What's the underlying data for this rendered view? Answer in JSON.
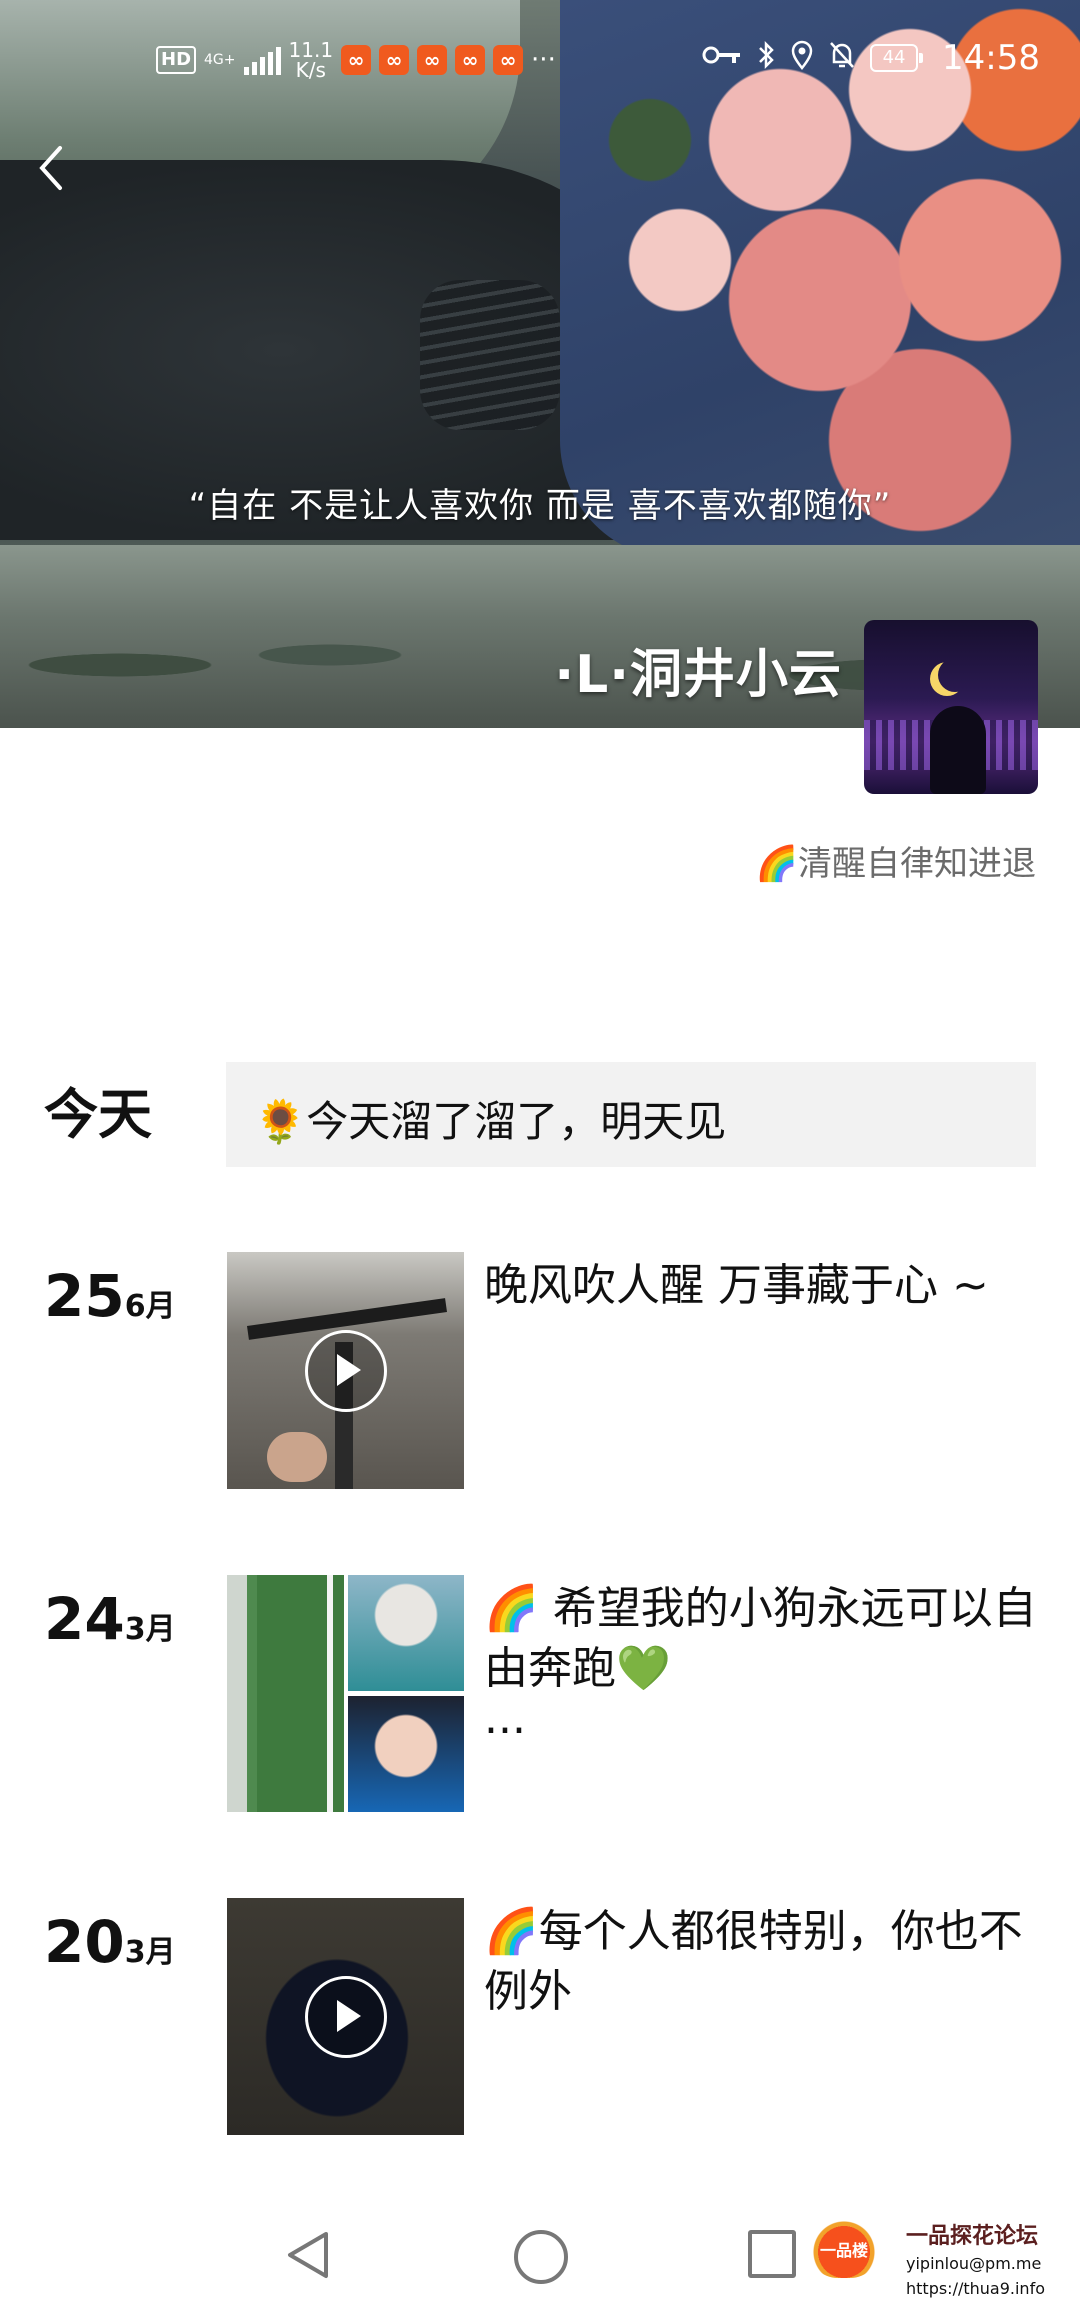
{
  "status_bar": {
    "hd": "HD",
    "network": "4G+",
    "speed_value": "11.1",
    "speed_unit": "K/s",
    "more": "···",
    "battery": "44",
    "time": "14:58"
  },
  "cover": {
    "caption": "“自在 不是让人喜欢你 而是 喜不喜欢都随你”"
  },
  "profile": {
    "nickname": "·L·洞井小云",
    "signature": "🌈清醒自律知进退"
  },
  "feed": [
    {
      "day": "今天",
      "month": "",
      "text": "🌻今天溜了溜了，明天见",
      "media": "none"
    },
    {
      "day": "25",
      "month": "6月",
      "text": "晚风吹人醒  万事藏于心 ~",
      "media": "video"
    },
    {
      "day": "24",
      "month": "3月",
      "text": "🌈 希望我的小狗永远可以自由奔跑💚",
      "more": "...",
      "media": "photos"
    },
    {
      "day": "20",
      "month": "3月",
      "text": "🌈每个人都很特别，你也不例外",
      "media": "video"
    }
  ],
  "watermark": {
    "logo_text": "一品楼",
    "title": "一品探花论坛",
    "email": "yipinlou@pm.me",
    "url": "https://thua9.info"
  },
  "icons": [
    "back-arrow-icon",
    "signal-icon",
    "app-notification-icon",
    "key-icon",
    "bluetooth-icon",
    "location-icon",
    "mute-bell-icon",
    "battery-icon",
    "play-icon",
    "nav-back-icon",
    "nav-home-icon",
    "nav-recent-icon"
  ]
}
